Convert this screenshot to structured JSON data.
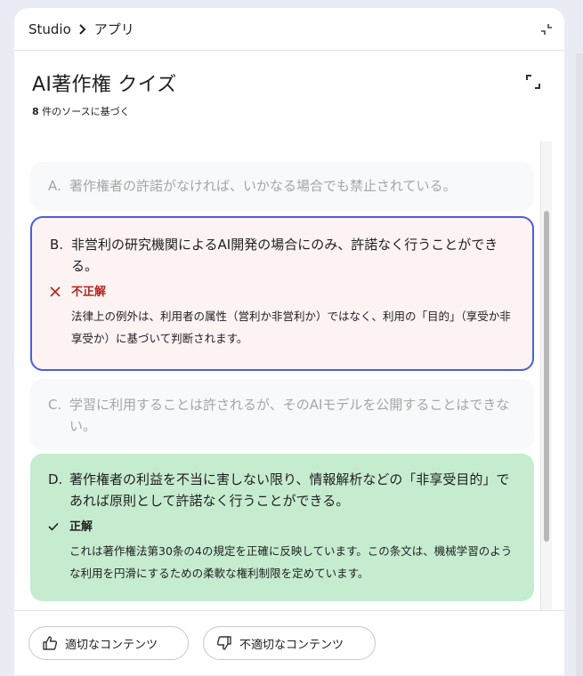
{
  "breadcrumb": {
    "root": "Studio",
    "current": "アプリ"
  },
  "header": {
    "title": "AI著作権 クイズ",
    "source_count": "8",
    "source_suffix": "件のソースに基づく"
  },
  "options": [
    {
      "letter": "A.",
      "text": "著作権者の許諾がなければ、いかなる場合でも禁止されている。"
    },
    {
      "letter": "B.",
      "text": "非営利の研究機関によるAI開発の場合にのみ、許諾なく行うことができる。",
      "verdict_label": "不正解",
      "verdict_text": "法律上の例外は、利用者の属性（営利か非営利か）ではなく、利用の「目的」（享受か非享受か）に基づいて判断されます。"
    },
    {
      "letter": "C.",
      "text": "学習に利用することは許されるが、そのAIモデルを公開することはできない。"
    },
    {
      "letter": "D.",
      "text": "著作権者の利益を不当に害しない限り、情報解析などの「非享受目的」であれば原則として許諾なく行うことができる。",
      "verdict_label": "正解",
      "verdict_text": "これは著作権法第30条の4の規定を正確に反映しています。この条文は、機械学習のような利用を円滑にするための柔軟な権利制限を定めています。"
    }
  ],
  "footer": {
    "good_label": "適切なコンテンツ",
    "bad_label": "不適切なコンテンツ"
  },
  "colors": {
    "selected_border": "#4a5fdc",
    "wrong": "#b3261e",
    "correct_bg": "#c6ecd0",
    "wrong_bg": "#fdf3f3"
  },
  "icons": {
    "breadcrumb_sep": "chevron-right-icon",
    "collapse": "collapse-icon",
    "expand": "expand-icon",
    "wrong": "close-icon",
    "correct": "check-icon",
    "good": "thumbs-up-icon",
    "bad": "thumbs-down-icon"
  }
}
